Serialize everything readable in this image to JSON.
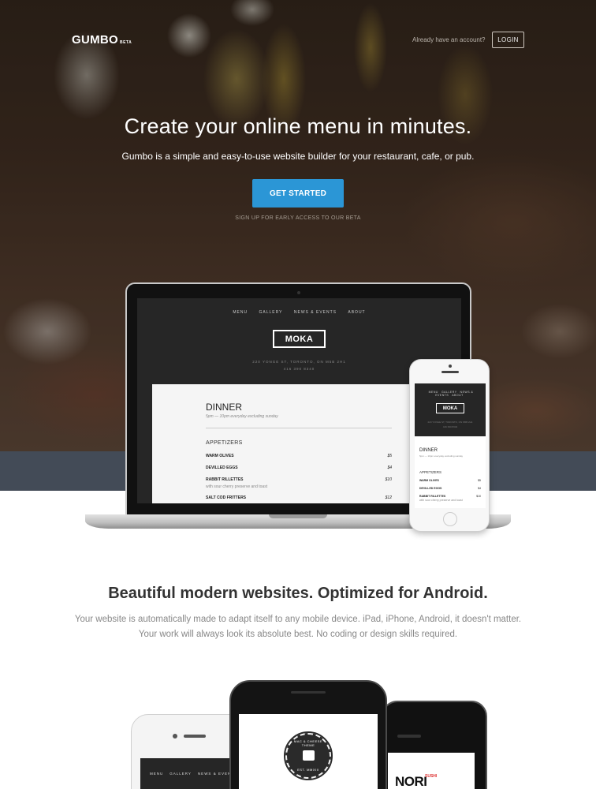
{
  "header": {
    "logo": "GUMBO",
    "logo_badge": "BETA",
    "account_prompt": "Already have an account?",
    "login_label": "LOGIN"
  },
  "hero": {
    "headline": "Create your online menu in minutes.",
    "subheadline": "Gumbo is a simple and easy-to-use website builder for your restaurant, cafe, or pub.",
    "cta_label": "GET STARTED",
    "cta_caption": "SIGN UP FOR EARLY ACCESS TO OUR BETA"
  },
  "laptop_site": {
    "nav": [
      "MENU",
      "GALLERY",
      "NEWS & EVENTS",
      "ABOUT"
    ],
    "brand": "MOKA",
    "address": "220 YONGE ST, TORONTO, ON M5B 2H1",
    "phone": "416 390 8340",
    "menu_title": "DINNER",
    "menu_hours": "5pm — 10pm everyday excluding sunday",
    "section": "APPETIZERS",
    "items": [
      {
        "name": "WARM OLIVES",
        "price": "$5",
        "desc": ""
      },
      {
        "name": "DEVILLED EGGS",
        "price": "$4",
        "desc": ""
      },
      {
        "name": "RABBIT RILLETTES",
        "price": "$10",
        "desc": "with sour cherry preserve and toast"
      },
      {
        "name": "SALT COD FRITTERS",
        "price": "$12",
        "desc": ""
      }
    ]
  },
  "phone_site": {
    "nav": [
      "MENU",
      "GALLERY",
      "NEWS & EVENTS",
      "ABOUT"
    ],
    "brand": "MOKA",
    "address": "220 YONGE ST, TORONTO, ON M5B 2H1",
    "phone": "416 390 8340",
    "menu_title": "DINNER",
    "menu_hours": "5pm — 10pm everyday excluding sunday",
    "section": "APPETIZERS",
    "items": [
      {
        "name": "WARM OLIVES",
        "price": "$5",
        "desc": ""
      },
      {
        "name": "DEVILLED EGGS",
        "price": "$4",
        "desc": ""
      },
      {
        "name": "RABBIT RILLETTES",
        "price": "$10",
        "desc": "with sour cherry preserve and toast"
      }
    ]
  },
  "features": {
    "title": "Beautiful modern websites. Optimized for Android.",
    "line1": "Your website is automatically made to adapt itself to any mobile device. iPad, iPhone, Android, it doesn't matter.",
    "line2": "Your work will always look its absolute best. No coding or design skills required."
  },
  "bottom_phones": {
    "left_nav": [
      "MENU",
      "GALLERY",
      "NEWS & EVENTS"
    ],
    "badge_top": "MAC & CHEESE THEME",
    "badge_bottom": "EST. MMXIII",
    "right_brand": "NORI",
    "right_brand_sup": "SUSHI"
  },
  "colors": {
    "cta": "#2b96d6",
    "band": "#434b57",
    "site_dark": "#262626"
  }
}
